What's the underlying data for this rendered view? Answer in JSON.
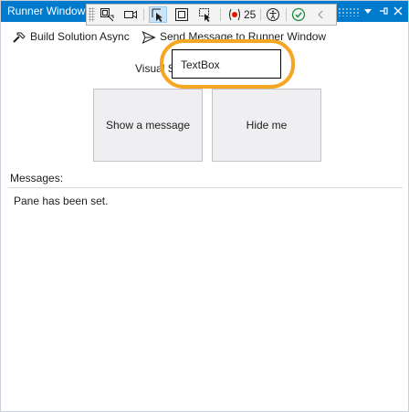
{
  "window": {
    "title": "Runner Window"
  },
  "debug_toolbar": {
    "buttons": [
      {
        "icon": "inspect-element-icon"
      },
      {
        "icon": "video-camera-icon"
      },
      {
        "icon": "select-element-icon",
        "selected": true
      },
      {
        "icon": "display-layout-adorners-icon"
      },
      {
        "icon": "track-focused-element-icon"
      },
      {
        "icon": "binding-failures-icon"
      },
      {
        "icon": "accessibility-icon"
      },
      {
        "icon": "check-circle-icon"
      },
      {
        "icon": "chevron-left-icon"
      }
    ],
    "binding_failures_count": "25"
  },
  "command_bar": {
    "build_label": "Build Solution Async",
    "send_label": "Send Message to Runner Window"
  },
  "main": {
    "visual_studio_label": "Visual S",
    "textbox_value": "TextBox",
    "show_message_label": "Show a message",
    "hide_me_label": "Hide me",
    "messages_label": "Messages:",
    "messages_text": "Pane has been set."
  },
  "colors": {
    "title_bar": "#007acc",
    "highlight": "#f5a623",
    "button_face": "#efeef1"
  }
}
